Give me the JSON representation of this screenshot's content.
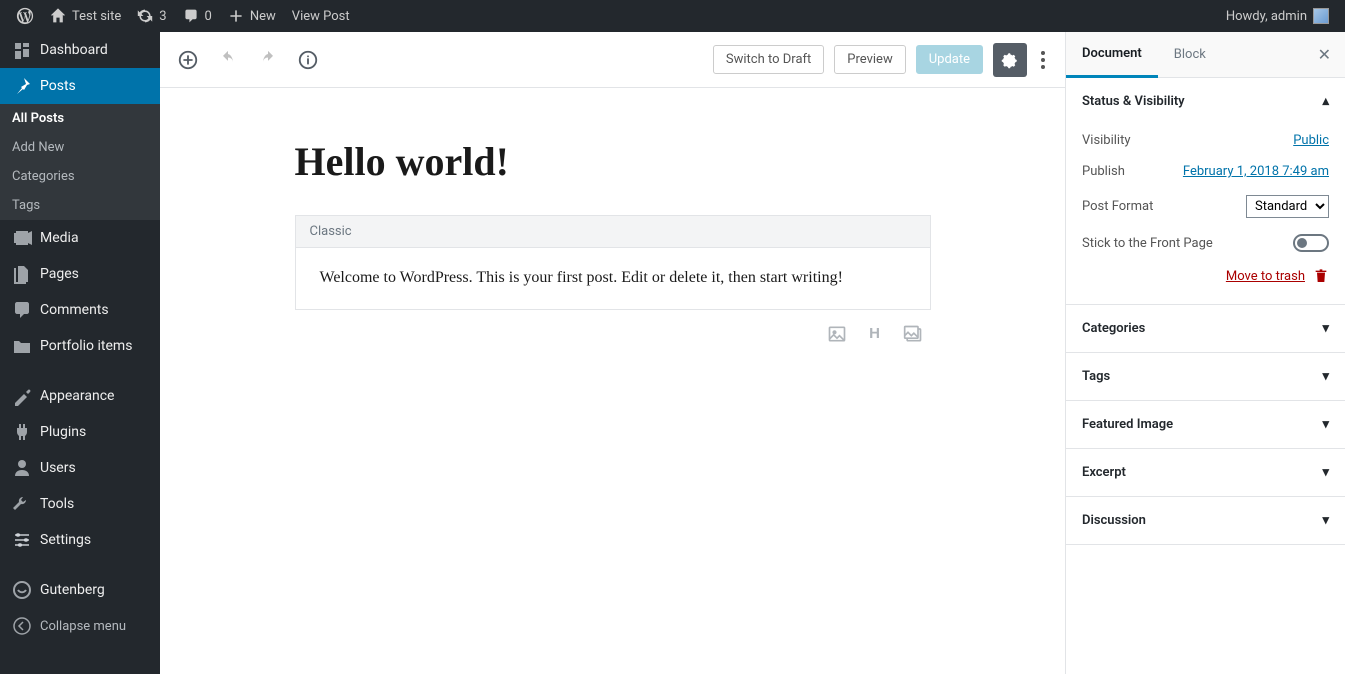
{
  "adminbar": {
    "site_name": "Test site",
    "updates_count": "3",
    "comments_count": "0",
    "new_label": "New",
    "view_post": "View Post",
    "howdy": "Howdy, admin"
  },
  "sidebar": {
    "items": [
      {
        "label": "Dashboard",
        "icon": "dashboard"
      },
      {
        "label": "Posts",
        "icon": "pin",
        "active": true
      },
      {
        "label": "Media",
        "icon": "media"
      },
      {
        "label": "Pages",
        "icon": "pages"
      },
      {
        "label": "Comments",
        "icon": "comments"
      },
      {
        "label": "Portfolio items",
        "icon": "portfolio"
      },
      {
        "label": "Appearance",
        "icon": "appearance"
      },
      {
        "label": "Plugins",
        "icon": "plugins"
      },
      {
        "label": "Users",
        "icon": "users"
      },
      {
        "label": "Tools",
        "icon": "tools"
      },
      {
        "label": "Settings",
        "icon": "settings"
      },
      {
        "label": "Gutenberg",
        "icon": "gutenberg"
      }
    ],
    "submenu": [
      "All Posts",
      "Add New",
      "Categories",
      "Tags"
    ],
    "collapse": "Collapse menu"
  },
  "editor": {
    "switch_draft": "Switch to Draft",
    "preview": "Preview",
    "update": "Update",
    "title": "Hello world!",
    "block_type": "Classic",
    "content": "Welcome to WordPress. This is your first post. Edit or delete it, then start writing!"
  },
  "inspector": {
    "tab_document": "Document",
    "tab_block": "Block",
    "panel_status": "Status & Visibility",
    "visibility_label": "Visibility",
    "visibility_value": "Public",
    "publish_label": "Publish",
    "publish_value": "February 1, 2018 7:49 am",
    "format_label": "Post Format",
    "format_value": "Standard",
    "sticky_label": "Stick to the Front Page",
    "trash_label": "Move to trash",
    "panels": [
      "Categories",
      "Tags",
      "Featured Image",
      "Excerpt",
      "Discussion"
    ]
  }
}
